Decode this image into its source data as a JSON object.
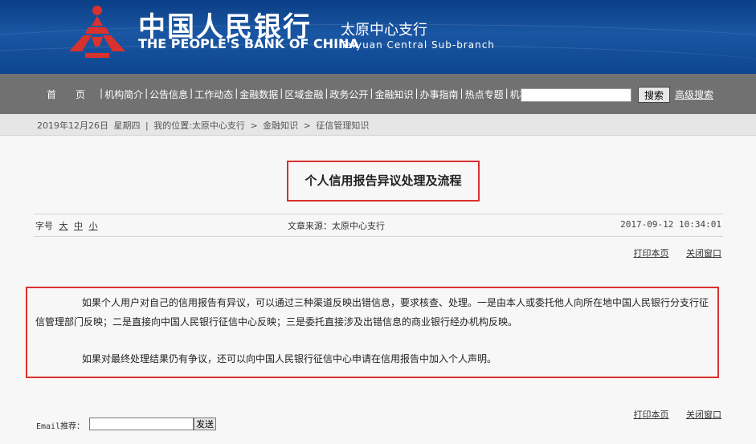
{
  "header": {
    "bank_name_cn": "中国人民银行",
    "bank_name_en": "THE PEOPLE'S BANK OF CHINA",
    "branch_cn": "太原中心支行",
    "branch_en": "Taiyuan  Central  Sub-branch",
    "logo_icon": "pboc-logo-icon",
    "colors": {
      "banner": "#1a56a3",
      "logo_red": "#d8312e"
    }
  },
  "nav": {
    "items": [
      "首　　页",
      "机构简介",
      "公告信息",
      "工作动态",
      "金融数据",
      "区域金融",
      "政务公开",
      "金融知识",
      "办事指南",
      "热点专题",
      "机构领导"
    ],
    "separator": "|",
    "search_button": "搜索",
    "advanced_search": "高级搜索"
  },
  "breadcrumb": {
    "date": "2019年12月26日",
    "weekday": "星期四",
    "separator": "|",
    "location_label": "我的位置:",
    "path": [
      "太原中心支行",
      "金融知识",
      "征信管理知识"
    ],
    "arrow": ">"
  },
  "article": {
    "title": "个人信用报告异议处理及流程",
    "font_size_label": "字号",
    "font_sizes": [
      "大",
      "中",
      "小"
    ],
    "source": "文章来源：太原中心支行",
    "datetime": "2017-09-12 10:34:01",
    "print_label": "打印本页",
    "close_label": "关闭窗口",
    "paragraphs": [
      "如果个人用户对自己的信用报告有异议，可以通过三种渠道反映出错信息，要求核查、处理。一是由本人或委托他人向所在地中国人民银行分支行征信管理部门反映；二是直接向中国人民银行征信中心反映；三是委托直接涉及出错信息的商业银行经办机构反映。",
      "如果对最终处理结果仍有争议，还可以向中国人民银行征信中心申请在信用报告中加入个人声明。"
    ],
    "highlight_color": "#d8312e"
  },
  "email": {
    "label": "Email推荐：",
    "send_button": "发送"
  }
}
